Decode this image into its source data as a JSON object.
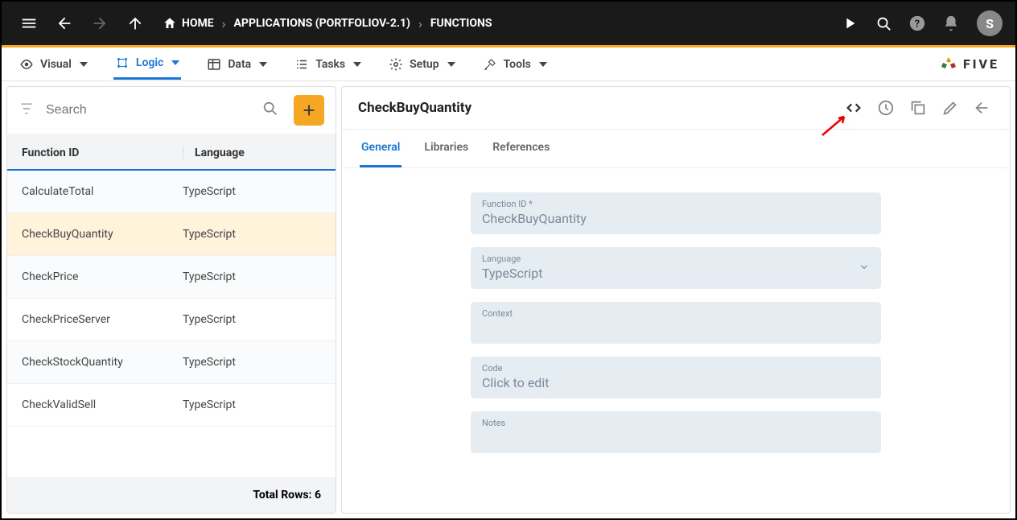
{
  "topbar": {
    "home": "HOME",
    "crumb_apps": "APPLICATIONS (PORTFOLIOV-2.1)",
    "crumb_funcs": "FUNCTIONS",
    "avatar": "S"
  },
  "menu": {
    "visual": "Visual",
    "logic": "Logic",
    "data": "Data",
    "tasks": "Tasks",
    "setup": "Setup",
    "tools": "Tools",
    "brand": "FIVE"
  },
  "list": {
    "search_placeholder": "Search",
    "col_id": "Function ID",
    "col_lang": "Language",
    "rows": [
      {
        "id": "CalculateTotal",
        "lang": "TypeScript"
      },
      {
        "id": "CheckBuyQuantity",
        "lang": "TypeScript"
      },
      {
        "id": "CheckPrice",
        "lang": "TypeScript"
      },
      {
        "id": "CheckPriceServer",
        "lang": "TypeScript"
      },
      {
        "id": "CheckStockQuantity",
        "lang": "TypeScript"
      },
      {
        "id": "CheckValidSell",
        "lang": "TypeScript"
      }
    ],
    "footer": "Total Rows: 6"
  },
  "detail": {
    "title": "CheckBuyQuantity",
    "tabs": {
      "general": "General",
      "libraries": "Libraries",
      "references": "References"
    },
    "fields": {
      "function_id_label": "Function ID *",
      "function_id_value": "CheckBuyQuantity",
      "language_label": "Language",
      "language_value": "TypeScript",
      "context_label": "Context",
      "context_value": "",
      "code_label": "Code",
      "code_value": "Click to edit",
      "notes_label": "Notes",
      "notes_value": ""
    }
  }
}
